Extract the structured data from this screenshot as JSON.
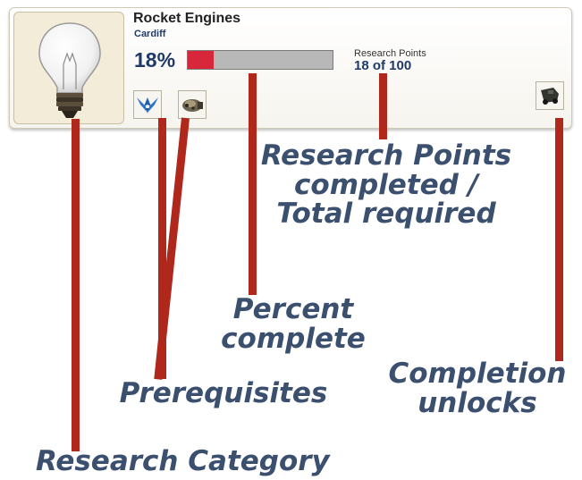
{
  "card": {
    "title": "Rocket Engines",
    "location": "Cardiff",
    "percent_text": "18%",
    "progress_fraction": 0.18,
    "research_points_label": "Research Points",
    "research_points_value": "18 of 100",
    "category_icon": "light-bulb-icon",
    "prerequisite_icons": [
      "air-force-wings-icon",
      "rocket-engine-icon"
    ],
    "unlock_icon": "rover-icon"
  },
  "annotations": {
    "research_points": [
      "Research Points",
      "completed /",
      "Total required"
    ],
    "percent": [
      "Percent",
      "complete"
    ],
    "completion": [
      "Completion",
      "unlocks"
    ],
    "prerequisites": "Prerequisites",
    "category": "Research Category"
  },
  "colors": {
    "progress_fill": "#d8263b",
    "progress_track": "#b8b8b8",
    "leader_line": "#b0281c",
    "annotation_text": "#3b4f6e",
    "value_text": "#1f3a6a"
  }
}
